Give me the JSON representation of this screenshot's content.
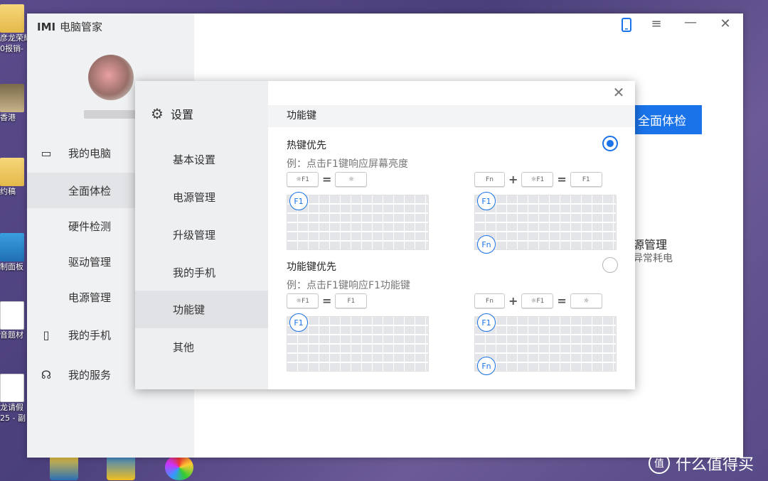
{
  "desktop": {
    "icons": [
      {
        "label": "彦龙荣耀",
        "top": 0
      },
      {
        "label": "0报销-",
        "top": 0
      },
      {
        "label": "香港",
        "top": 0
      },
      {
        "label": "约稿",
        "top": 0
      },
      {
        "label": "制面板",
        "top": 0
      },
      {
        "label": "音题材",
        "top": 0
      },
      {
        "label": "龙请假",
        "top": 0
      },
      {
        "label": "25 - 副",
        "top": 0
      }
    ]
  },
  "app": {
    "logo": "IMI",
    "title": "电脑管家",
    "nav": [
      {
        "label": "我的电脑",
        "icon": "laptop-icon"
      },
      {
        "label": "全面体检"
      },
      {
        "label": "硬件检测"
      },
      {
        "label": "驱动管理"
      },
      {
        "label": "电源管理"
      },
      {
        "label": "我的手机",
        "icon": "phone-icon"
      },
      {
        "label": "我的服务",
        "icon": "headset-icon"
      }
    ],
    "checkup_button": "全面体检",
    "power_title": "源管理",
    "power_sub": "异常耗电"
  },
  "settings": {
    "title": "设置",
    "items": [
      "基本设置",
      "电源管理",
      "升级管理",
      "我的手机",
      "功能键",
      "其他"
    ],
    "active_item": "功能键",
    "section_title": "功能键",
    "options": [
      {
        "title": "热键优先",
        "desc": "例：点击F1键响应屏幕亮度",
        "selected": true,
        "left_combo": [
          "F1",
          "☼"
        ],
        "right_combo": [
          "Fn",
          "F1",
          "F1"
        ]
      },
      {
        "title": "功能键优先",
        "desc": "例：点击F1键响应F1功能键",
        "selected": false,
        "left_combo": [
          "F1",
          "F1"
        ],
        "right_combo": [
          "Fn",
          "F1",
          "☼"
        ]
      }
    ],
    "badge_f1": "F1",
    "badge_fn": "Fn",
    "op_equals": "=",
    "op_plus": "+"
  },
  "watermark": "什么值得买",
  "colors": {
    "accent": "#1a73e8"
  }
}
